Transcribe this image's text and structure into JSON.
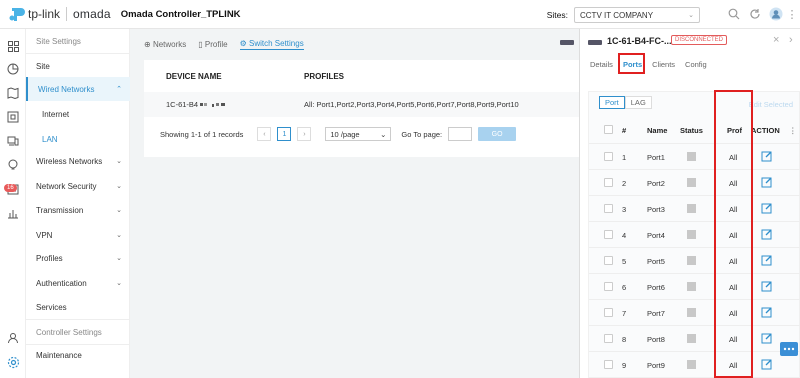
{
  "brand": {
    "tplink": "tp-link",
    "omada": "omada"
  },
  "app_title": "Omada Controller_TPLINK",
  "sites": {
    "label": "Sites:",
    "selected": "CCTV IT COMPANY"
  },
  "notifications_count": "16",
  "sidenav": {
    "site_settings": "Site Settings",
    "site": "Site",
    "wired_networks": "Wired Networks",
    "internet": "Internet",
    "lan": "LAN",
    "wireless_networks": "Wireless Networks",
    "network_security": "Network Security",
    "transmission": "Transmission",
    "vpn": "VPN",
    "profiles": "Profiles",
    "authentication": "Authentication",
    "services": "Services",
    "controller_settings": "Controller Settings",
    "maintenance": "Maintenance"
  },
  "breadcrumbs": {
    "networks": "Networks",
    "profile": "Profile",
    "switch_settings": "Switch Settings"
  },
  "table": {
    "col_device": "DEVICE NAME",
    "col_profiles": "PROFILES",
    "rows": [
      {
        "device": "1C-61-B4",
        "profiles": "All: Port1,Port2,Port3,Port4,Port5,Port6,Port7,Port8,Port9,Port10"
      }
    ],
    "showing": "Showing 1-1 of 1 records",
    "page": "1",
    "per_page": "10 /page",
    "goto_label": "Go To page:",
    "go": "GO"
  },
  "panel": {
    "device": "1C-61-B4-FC-...",
    "status": "DISCONNECTED",
    "tabs": [
      "Details",
      "Ports",
      "Clients",
      "Config"
    ],
    "seg_tabs": [
      "Port",
      "LAG"
    ],
    "edit_selected": "Edit Selected",
    "cols": {
      "num": "#",
      "name": "Name",
      "status": "Status",
      "prof": "Prof",
      "action": "ACTION"
    },
    "ports": [
      {
        "num": "1",
        "name": "Port1",
        "prof": "All"
      },
      {
        "num": "2",
        "name": "Port2",
        "prof": "All"
      },
      {
        "num": "3",
        "name": "Port3",
        "prof": "All"
      },
      {
        "num": "4",
        "name": "Port4",
        "prof": "All"
      },
      {
        "num": "5",
        "name": "Port5",
        "prof": "All"
      },
      {
        "num": "6",
        "name": "Port6",
        "prof": "All"
      },
      {
        "num": "7",
        "name": "Port7",
        "prof": "All"
      },
      {
        "num": "8",
        "name": "Port8",
        "prof": "All"
      },
      {
        "num": "9",
        "name": "Port9",
        "prof": "All"
      }
    ]
  },
  "colors": {
    "accent": "#2f8fcc",
    "highlight_box": "#e02020",
    "error": "#e35b5b"
  }
}
